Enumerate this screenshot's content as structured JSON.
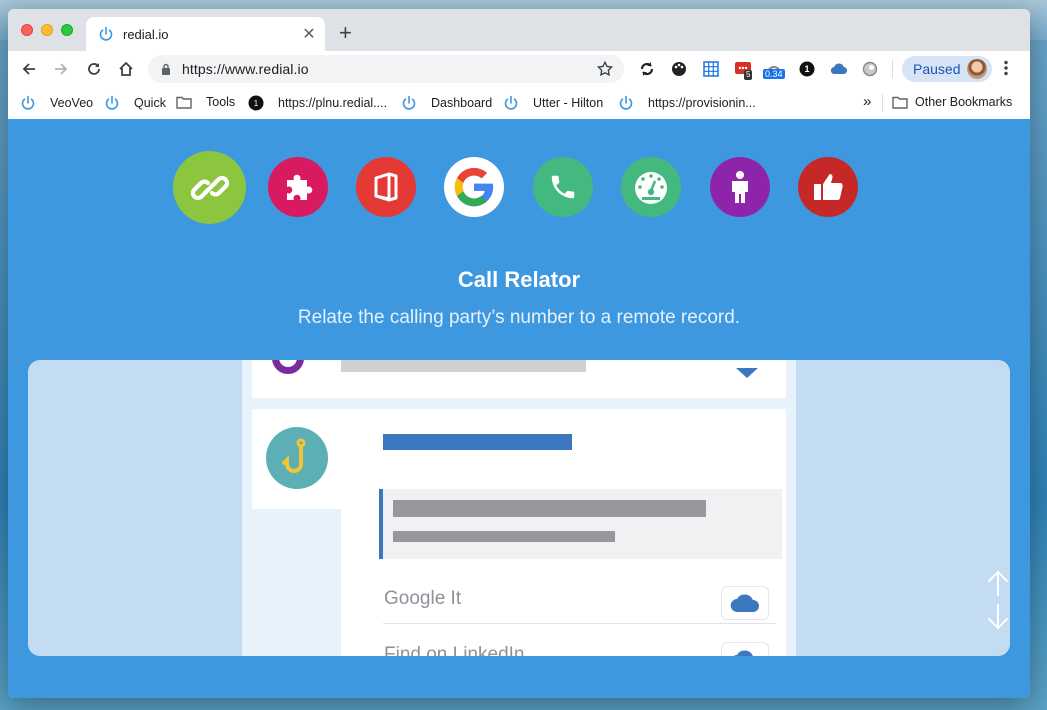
{
  "browser": {
    "tab": {
      "title": "redial.io"
    },
    "url": "https://www.redial.io",
    "profile": {
      "label": "Paused"
    },
    "extensions": {
      "badge_count": "5",
      "badge_value": "0.34",
      "onepassword_label": "1"
    },
    "bookmarks": [
      {
        "label": "VeoVeo",
        "icon": "power-icon"
      },
      {
        "label": "Quick",
        "icon": "power-icon"
      },
      {
        "label": "Tools",
        "icon": "folder-icon"
      },
      {
        "label": "https://plnu.redial....",
        "icon": "onepassword-icon"
      },
      {
        "label": "Dashboard",
        "icon": "power-icon"
      },
      {
        "label": "Utter - Hilton",
        "icon": "power-icon"
      },
      {
        "label": "https://provisionin...",
        "icon": "power-icon"
      }
    ],
    "overflow_label": "»",
    "other_bookmarks": "Other Bookmarks"
  },
  "page": {
    "features": [
      {
        "name": "link",
        "color": "#8cc63f",
        "active": true
      },
      {
        "name": "puzzle",
        "color": "#d81b60"
      },
      {
        "name": "office",
        "color": "#e53935"
      },
      {
        "name": "google",
        "color": "#ffffff"
      },
      {
        "name": "phone",
        "color": "#43b97f"
      },
      {
        "name": "dashboard",
        "color": "#43b97f"
      },
      {
        "name": "person",
        "color": "#8e24aa"
      },
      {
        "name": "thumbs-up",
        "color": "#c62828"
      }
    ],
    "title": "Call Relator",
    "subtitle": "Relate the calling party’s number to a remote record.",
    "preview": {
      "actions": [
        {
          "label": "Google It",
          "icon": "cloud-icon"
        },
        {
          "label": "Find on LinkedIn",
          "icon": "cloud-icon"
        }
      ]
    }
  },
  "colors": {
    "page_bg": "#3e98e0",
    "accent": "#3b78bf"
  }
}
